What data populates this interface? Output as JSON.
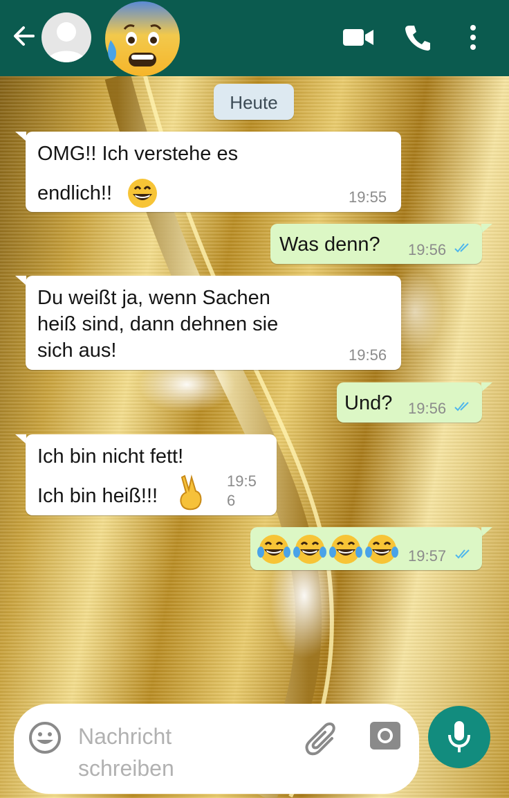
{
  "colors": {
    "header": "#0b5b4f",
    "incoming": "#ffffff",
    "outgoing": "#dcf7c5",
    "read_ticks": "#4fb6ec",
    "mic_button": "#128c7e"
  },
  "header": {
    "back_icon": "arrow-left-icon",
    "avatar_icon": "default-avatar-icon",
    "emoji": "anxious-face-with-sweat",
    "icons": [
      "video-call-icon",
      "phone-icon",
      "more-vert-icon"
    ]
  },
  "date_chip": "Heute",
  "messages": [
    {
      "dir": "in",
      "lines": [
        "OMG!! Ich verstehe es",
        "endlich!!"
      ],
      "emoji": "grinning-face",
      "time": "19:55"
    },
    {
      "dir": "out",
      "lines": [
        "Was denn?"
      ],
      "time": "19:56",
      "read": true
    },
    {
      "dir": "in",
      "lines": [
        "Du weißt ja, wenn Sachen",
        "heiß sind, dann dehnen sie",
        "sich aus!"
      ],
      "time": "19:56"
    },
    {
      "dir": "out",
      "lines": [
        "Und?"
      ],
      "time": "19:56",
      "read": true
    },
    {
      "dir": "in",
      "lines": [
        "Ich bin nicht fett!",
        "Ich bin heiß!!!"
      ],
      "emoji": "victory-hand",
      "time_lines": [
        "19:5",
        "6"
      ]
    },
    {
      "dir": "out",
      "emoji": "face-with-tears-of-joy x4",
      "time": "19:57",
      "read": true
    }
  ],
  "composer": {
    "placeholder_lines": [
      "Nachricht",
      "schreiben"
    ],
    "icons": [
      "emoji-icon",
      "attach-icon",
      "camera-icon",
      "mic-icon"
    ]
  }
}
